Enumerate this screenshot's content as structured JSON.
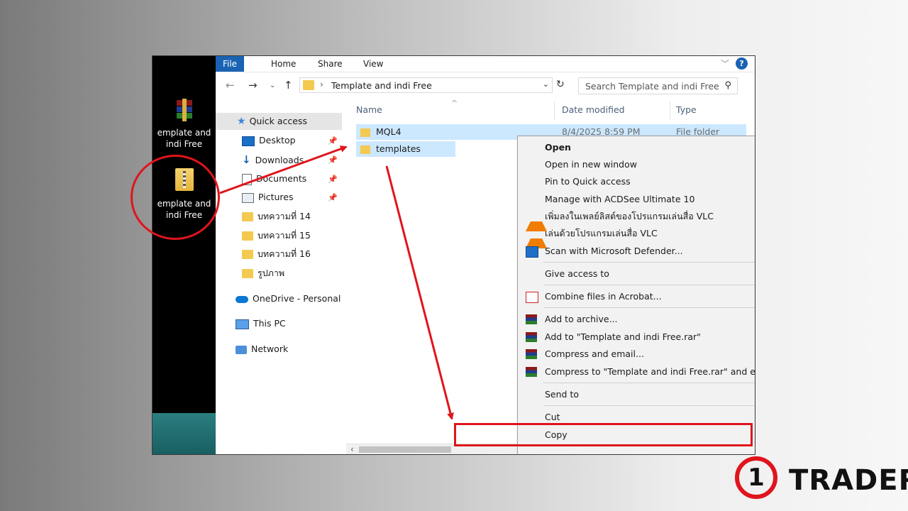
{
  "desktop": {
    "icons": [
      {
        "label_line1": "emplate and",
        "label_line2": "indi Free",
        "icon": "winrar-archive-icon"
      },
      {
        "label_line1": "emplate and",
        "label_line2": "indi Free",
        "icon": "zip-folder-icon"
      }
    ]
  },
  "ribbon": {
    "tabs": [
      "File",
      "Home",
      "Share",
      "View"
    ],
    "help": "?"
  },
  "address": {
    "path": "Template and indi Free",
    "search_placeholder": "Search Template and indi Free"
  },
  "nav": {
    "items": [
      {
        "label": "Quick access",
        "icon": "star-icon"
      },
      {
        "label": "Desktop",
        "icon": "desktop-icon"
      },
      {
        "label": "Downloads",
        "icon": "download-icon"
      },
      {
        "label": "Documents",
        "icon": "documents-icon"
      },
      {
        "label": "Pictures",
        "icon": "pictures-icon"
      },
      {
        "label": "บทความที่ 14",
        "icon": "folder-icon"
      },
      {
        "label": "บทความที่ 15",
        "icon": "folder-icon"
      },
      {
        "label": "บทความที่ 16",
        "icon": "folder-icon"
      },
      {
        "label": "รูปภาพ",
        "icon": "folder-icon"
      },
      {
        "label": "OneDrive - Personal",
        "icon": "onedrive-icon"
      },
      {
        "label": "This PC",
        "icon": "pc-icon"
      },
      {
        "label": "Network",
        "icon": "network-icon"
      }
    ]
  },
  "columns": {
    "name": "Name",
    "date": "Date modified",
    "type": "Type"
  },
  "files": [
    {
      "name": "MQL4",
      "date": "8/4/2025 8:59 PM",
      "type": "File folder"
    },
    {
      "name": "templates",
      "date": "",
      "type": ""
    }
  ],
  "context_menu": {
    "items": [
      {
        "label": "Open",
        "icon": ""
      },
      {
        "label": "Open in new window",
        "icon": ""
      },
      {
        "label": "Pin to Quick access",
        "icon": ""
      },
      {
        "label": "Manage with ACDSee Ultimate 10",
        "icon": ""
      },
      {
        "label": "เพิ่มลงในเพลย์ลิสต์ของโปรแกรมเล่นสื่อ VLC",
        "icon": "vlc-icon"
      },
      {
        "label": "เล่นด้วยโปรแกรมเล่นสื่อ VLC",
        "icon": "vlc-icon"
      },
      {
        "label": "Scan with Microsoft Defender...",
        "icon": "defender-shield-icon"
      },
      {
        "label": "Give access to",
        "icon": ""
      },
      {
        "label": "Combine files in Acrobat...",
        "icon": "acrobat-icon"
      },
      {
        "label": "Add to archive...",
        "icon": "winrar-icon"
      },
      {
        "label": "Add to \"Template and indi Free.rar\"",
        "icon": "winrar-icon"
      },
      {
        "label": "Compress and email...",
        "icon": "winrar-icon"
      },
      {
        "label": "Compress to \"Template and indi Free.rar\" and email",
        "icon": "winrar-icon"
      },
      {
        "label": "Send to",
        "icon": ""
      },
      {
        "label": "Cut",
        "icon": ""
      },
      {
        "label": "Copy",
        "icon": ""
      }
    ]
  },
  "brand": {
    "numeral": "1",
    "word": "TRADER",
    "accent": "#e0141c"
  }
}
